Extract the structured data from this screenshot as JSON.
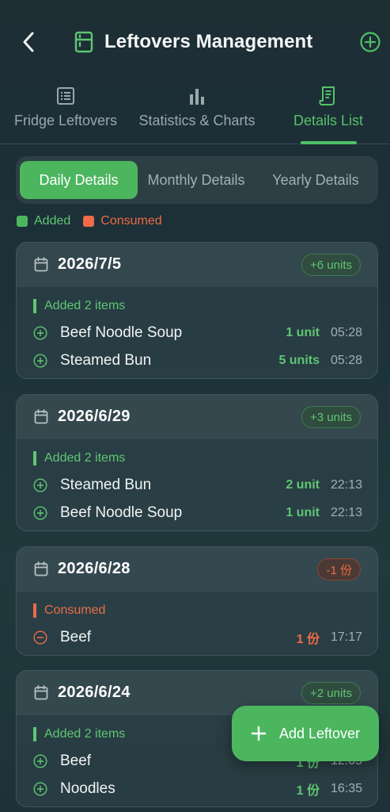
{
  "header": {
    "title": "Leftovers Management",
    "icons": {
      "back": "back-arrow-icon",
      "title": "fridge-icon",
      "add": "add-circle-icon"
    }
  },
  "tabs": [
    {
      "label": "Fridge Leftovers",
      "icon": "list-icon",
      "active": false
    },
    {
      "label": "Statistics & Charts",
      "icon": "bar-chart-icon",
      "active": false
    },
    {
      "label": "Details List",
      "icon": "receipt-icon",
      "active": true
    }
  ],
  "period_tabs": [
    {
      "label": "Daily Details",
      "active": true
    },
    {
      "label": "Monthly Details",
      "active": false
    },
    {
      "label": "Yearly Details",
      "active": false
    }
  ],
  "legend": {
    "added": "Added",
    "consumed": "Consumed"
  },
  "colors": {
    "accent": "#4cb65f",
    "added": "#5fc673",
    "consumed": "#ef6a47"
  },
  "days": [
    {
      "date": "2026/7/5",
      "badge": "+6 units",
      "section": "Added 2 items",
      "items": [
        {
          "name": "Beef Noodle Soup",
          "qty": "1 unit",
          "time": "05:28"
        },
        {
          "name": "Steamed Bun",
          "qty": "5 units",
          "time": "05:28"
        }
      ]
    },
    {
      "date": "2026/6/29",
      "badge": "+3 units",
      "section": "Added 2 items",
      "items": [
        {
          "name": "Steamed Bun",
          "qty": "2 unit",
          "time": "22:13"
        },
        {
          "name": "Beef Noodle Soup",
          "qty": "1 unit",
          "time": "22:13"
        }
      ]
    },
    {
      "date": "2026/6/28",
      "badge": "-1 份",
      "section": "Consumed",
      "items": [
        {
          "name": "Beef",
          "qty": "1 份",
          "time": "17:17"
        }
      ]
    },
    {
      "date": "2026/6/24",
      "badge": "+2 units",
      "section": "Added 2 items",
      "items": [
        {
          "name": "Beef",
          "qty": "1 份",
          "time": "12:05"
        },
        {
          "name": "Noodles",
          "qty": "1 份",
          "time": "16:35"
        }
      ]
    }
  ],
  "fab": {
    "label": "Add Leftover",
    "icon": "plus-icon"
  }
}
